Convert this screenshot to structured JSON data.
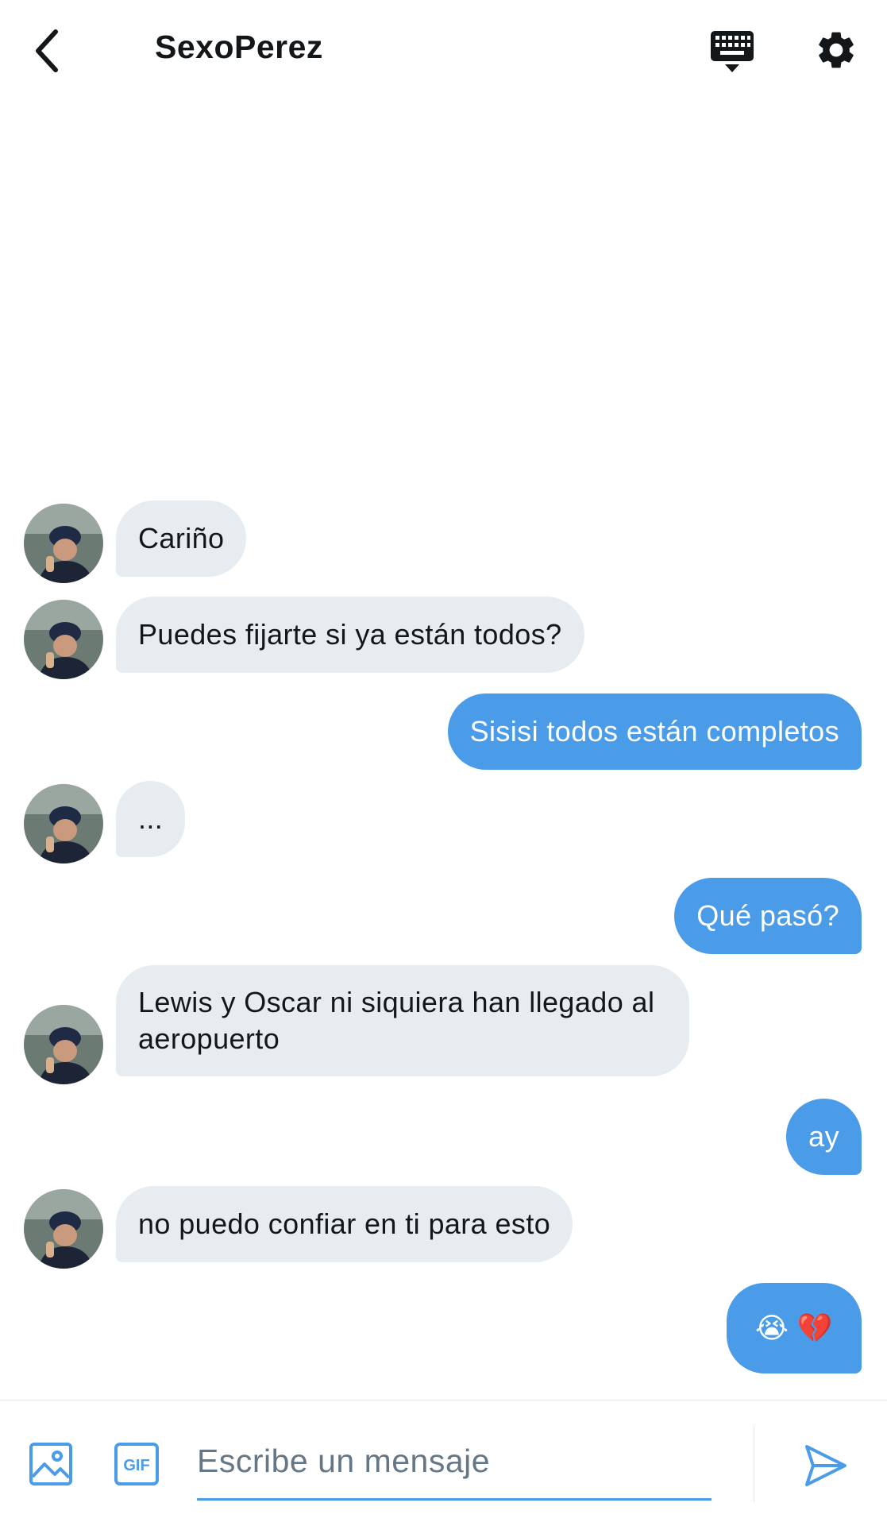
{
  "header": {
    "title": "SexoPerez"
  },
  "messages": [
    {
      "side": "in",
      "text": "Cariño"
    },
    {
      "side": "in",
      "text": "Puedes fijarte si ya están todos?"
    },
    {
      "side": "out",
      "text": "Sisisi todos están completos"
    },
    {
      "side": "in",
      "text": "..."
    },
    {
      "side": "out",
      "text": "Qué pasó?"
    },
    {
      "side": "in",
      "text": "Lewis y Oscar ni siquiera han llegado al aeropuerto"
    },
    {
      "side": "out",
      "text": "ay"
    },
    {
      "side": "in",
      "text": "no puedo confiar en ti para esto"
    },
    {
      "side": "out",
      "text": "😭 💔"
    }
  ],
  "composer": {
    "placeholder": "Escribe un mensaje",
    "gif_label": "GIF"
  },
  "icons": {
    "back": "chevron-left-icon",
    "keyboard": "keyboard-icon",
    "settings": "gear-icon",
    "image": "image-icon",
    "gif": "gif-icon",
    "send": "send-icon"
  },
  "colors": {
    "outgoing_bubble": "#4a9ce8",
    "incoming_bubble": "#e6ecf0",
    "accent": "#4a9ce8"
  }
}
